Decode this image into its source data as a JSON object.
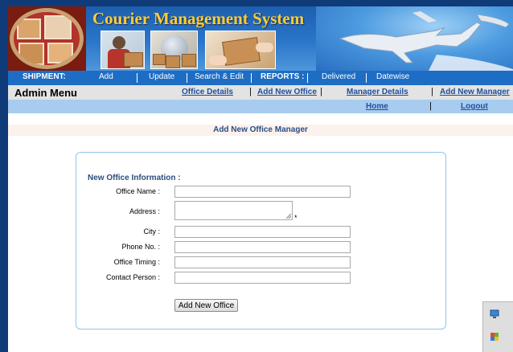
{
  "header": {
    "title": "Courier Management System"
  },
  "shipment_nav": {
    "label": "SHIPMENT:",
    "items": [
      "Add",
      "Update",
      "Search & Edit"
    ],
    "reports_label": "REPORTS :",
    "report_items": [
      "Delivered",
      "Datewise"
    ]
  },
  "admin_menu": {
    "title": "Admin Menu",
    "links": [
      "Office Details",
      "Add New Office",
      "Manager Details",
      "Add New Manager"
    ],
    "separator": "|",
    "sub_links": [
      "Home",
      "Logout"
    ]
  },
  "page": {
    "heading": "Add New Office Manager"
  },
  "form": {
    "section_title": "New Office Information :",
    "fields": [
      {
        "label": "Office Name :",
        "value": ""
      },
      {
        "label": "Address :",
        "value": ""
      },
      {
        "label": "City :",
        "value": ""
      },
      {
        "label": "Phone No. :",
        "value": ""
      },
      {
        "label": "Office Timing :",
        "value": ""
      },
      {
        "label": "Contact Person :",
        "value": ""
      }
    ],
    "required_marker": "*",
    "submit_label": "Add New Office"
  },
  "colors": {
    "page_background": "#0f3b78",
    "nav_blue": "#1e6dc4",
    "title_gold": "#ffcc33",
    "link_blue": "#1f4f9a",
    "heading_blue": "#2b4d7f",
    "form_border": "#8ec5ec"
  },
  "icons": {
    "tray": [
      "network-icon",
      "flag-icon"
    ]
  }
}
